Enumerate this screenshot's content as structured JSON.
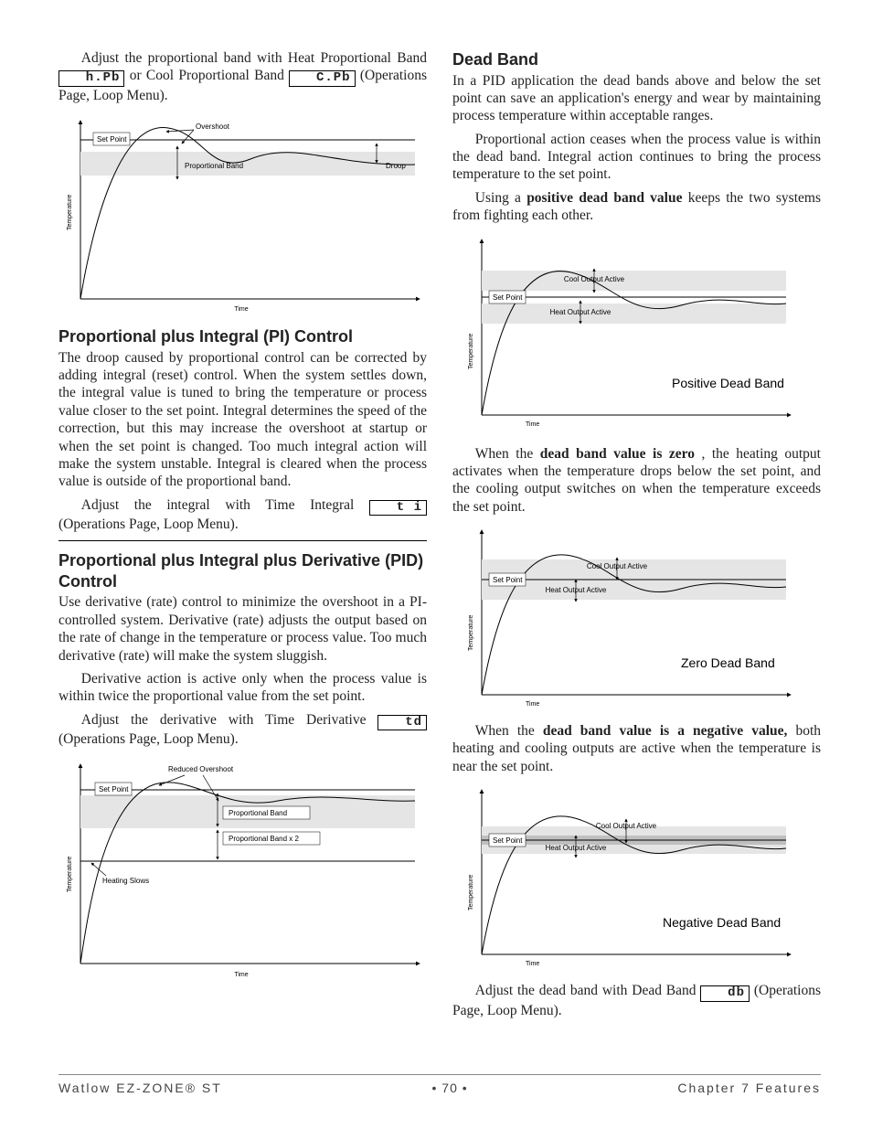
{
  "left": {
    "para1_a": "Adjust the proportional band with Heat Proportional Band ",
    "param_hpb": "h.Pb",
    "para1_b": " or Cool Proportional Band ",
    "param_cpb": "C.Pb",
    "para1_c": " (Operations Page, Loop Menu).",
    "h_pi": "Proportional plus Integral (PI) Control",
    "pi_para1": "The droop caused by proportional control can be corrected by adding integral (reset) control. When the system settles down, the integral value is tuned to bring the temperature or process value closer to the set point. Integral determines the speed of the correction, but this may increase the overshoot at startup or when the set point is changed. Too much integral action will make the system unstable. Integral is cleared when the process value is outside of the proportional band.",
    "pi_para2_a": "Adjust the integral with Time Integral ",
    "param_ti": "t i",
    "pi_para2_b": " (Operations Page, Loop Menu).",
    "h_pid": "Proportional plus Integral plus Derivative (PID) Control",
    "pid_para1": "Use derivative (rate) control to minimize the overshoot in a PI-controlled system. Derivative (rate) adjusts the output based on the rate of change in the temperature or process value. Too much derivative (rate) will make the system sluggish.",
    "pid_para2": "Derivative action is active only when the process value is within twice the proportional value from the set point.",
    "pid_para3_a": "Adjust the derivative with Time Derivative ",
    "param_td": "td",
    "pid_para3_b": " (Operations Page, Loop Menu)."
  },
  "right": {
    "h_db": "Dead Band",
    "db_para1": "In a PID application the dead bands above and below the set point can save an application's energy and wear by maintaining process temperature within acceptable ranges.",
    "db_para2": "Proportional action ceases when the process value is within the dead band. Integral action continues to bring the process temperature to the set point.",
    "db_para3_a": "Using a ",
    "db_para3_b": "positive dead band value",
    "db_para3_c": " keeps the two systems from fighting each other.",
    "db_para4_a": "When the ",
    "db_para4_b": "dead band value is zero",
    "db_para4_c": ", the heating output activates when the temperature drops below the set point, and the cooling output switches on when the temperature exceeds the set point.",
    "db_para5_a": "When the ",
    "db_para5_b": "dead band value is a negative value,",
    "db_para5_c": " both heating and cooling outputs are active when the temperature is near the set point.",
    "db_para6_a": "Adjust the dead band with Dead Band ",
    "param_db": "db",
    "db_para6_b": " (Operations Page, Loop Menu)."
  },
  "chart1": {
    "y_label": "Temperature",
    "x_label": "Time",
    "set_point": "Set Point",
    "overshoot": "Overshoot",
    "prop_band": "Proportional Band",
    "droop": "Droop"
  },
  "chart2": {
    "y_label": "Temperature",
    "x_label": "Time",
    "set_point": "Set Point",
    "reduced": "Reduced Overshoot",
    "pb": "Proportional Band",
    "pb2": "Proportional Band x 2",
    "slows": "Heating Slows"
  },
  "chart_db": {
    "y_label": "Temperature",
    "x_label": "Time",
    "set_point": "Set Point",
    "cool": "Cool Output Active",
    "heat": "Heat Output Active",
    "cap_pos": "Positive Dead Band",
    "cap_zero": "Zero Dead Band",
    "cap_neg": "Negative Dead Band"
  },
  "footer": {
    "left": "Watlow EZ-ZONE® ST",
    "center": "•  70  •",
    "right": "Chapter 7 Features"
  }
}
